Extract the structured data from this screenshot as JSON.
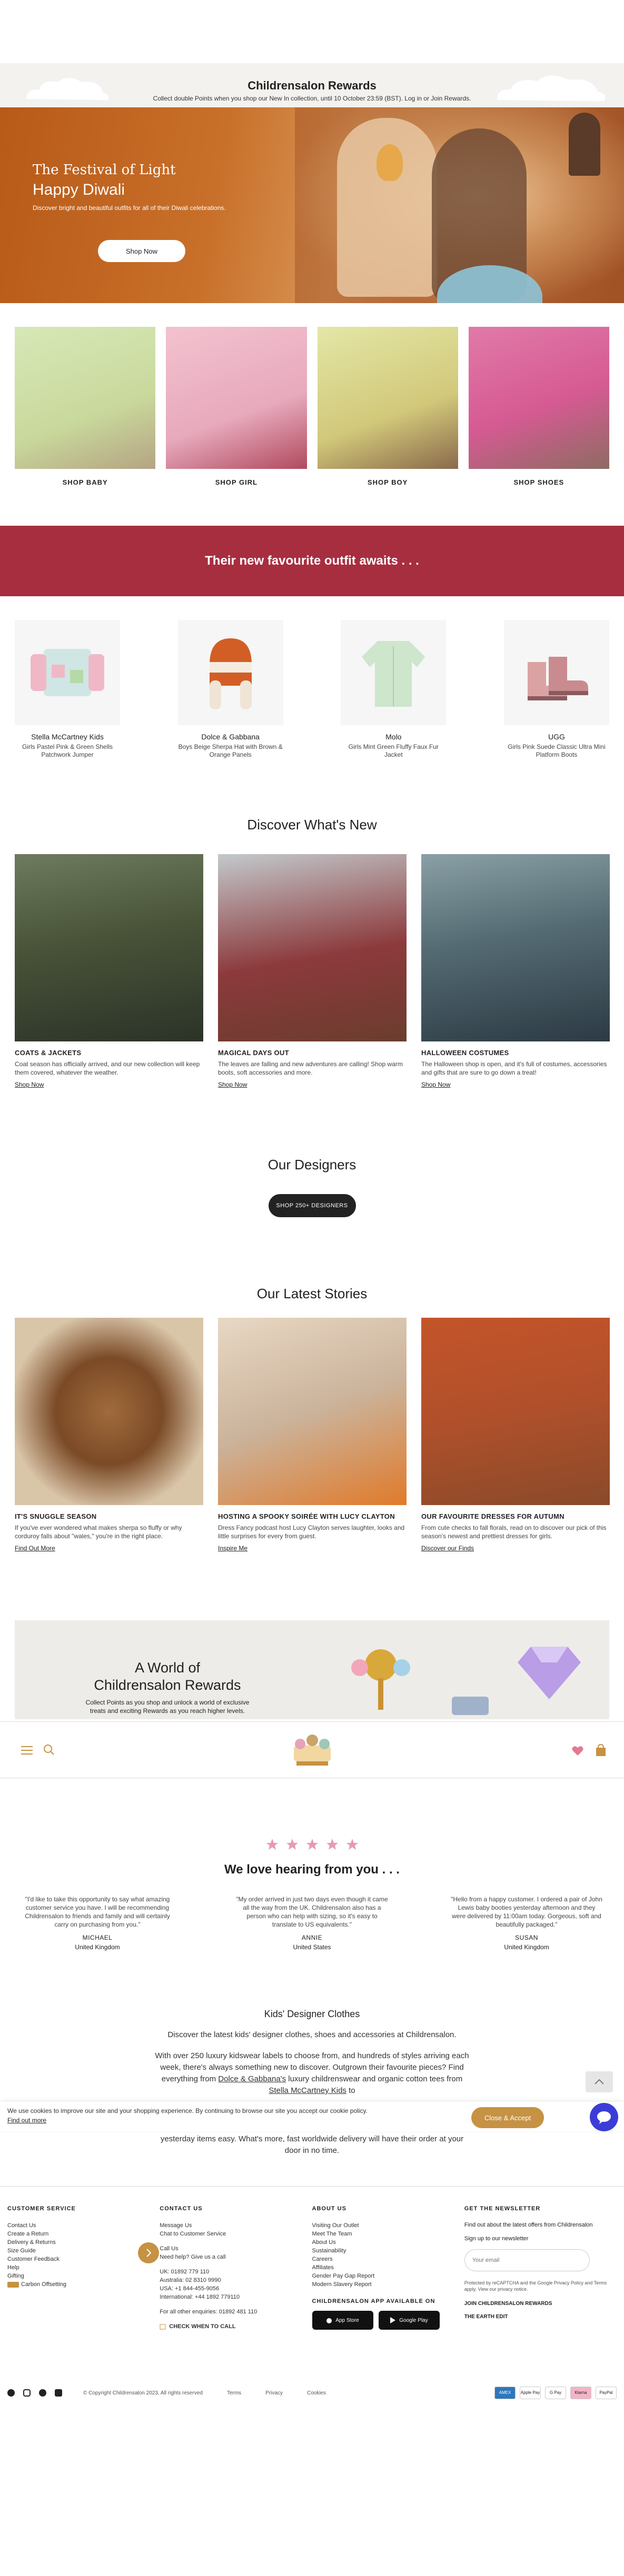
{
  "rewards_bar": {
    "title": "Childrensalon Rewards",
    "text": "Collect double Points when you shop our New In collection, until 10 October 23:59 (BST). Log in or Join Rewards."
  },
  "hero": {
    "heading_script": "The Festival of Light",
    "heading": "Happy Diwali",
    "subtext": "Discover bright and beautiful outfits for all of their Diwali celebrations.",
    "button": "Shop Now"
  },
  "shop_categories": [
    "SHOP BABY",
    "SHOP GIRL",
    "SHOP BOY",
    "SHOP SHOES"
  ],
  "promo": {
    "title": "Their new favourite outfit awaits . . ."
  },
  "products": [
    {
      "brand": "Stella McCartney Kids",
      "name": "Girls Pastel Pink & Green Shells Patchwork Jumper"
    },
    {
      "brand": "Dolce & Gabbana",
      "name": "Boys Beige Sherpa Hat with Brown & Orange Panels"
    },
    {
      "brand": "Molo",
      "name": "Girls Mint Green Fluffy Faux Fur Jacket"
    },
    {
      "brand": "UGG",
      "name": "Girls Pink Suede Classic Ultra Mini Platform Boots"
    }
  ],
  "whats_new": {
    "title": "Discover What's New",
    "cards": [
      {
        "title": "COATS & JACKETS",
        "text": "Coat season has officially arrived, and our new collection will keep them covered, whatever the weather.",
        "link": "Shop Now"
      },
      {
        "title": "MAGICAL DAYS OUT",
        "text": "The leaves are falling and new adventures are calling! Shop warm boots, soft accessories and more.",
        "link": "Shop Now"
      },
      {
        "title": "HALLOWEEN COSTUMES",
        "text": "The Halloween shop is open, and it's full of costumes, accessories and gifts that are sure to go down a treat!",
        "link": "Shop Now"
      }
    ]
  },
  "designers": {
    "title": "Our Designers",
    "button": "SHOP 250+ DESIGNERS"
  },
  "stories": {
    "title": "Our Latest Stories",
    "cards": [
      {
        "title": "IT'S SNUGGLE SEASON",
        "text": "If you've ever wondered what makes sherpa so fluffy or why corduroy falls about \"wales,\" you're in the right place.",
        "link": "Find Out More"
      },
      {
        "title": "HOSTING A SPOOKY SOIRÉE WITH LUCY CLAYTON",
        "text": "Dress Fancy podcast host Lucy Clayton serves laughter, looks and little surprises for every from guest.",
        "link": "Inspire Me"
      },
      {
        "title": "OUR FAVOURITE DRESSES FOR AUTUMN",
        "text": "From cute checks to fall florals, read on to discover our pick of this season's newest and prettiest dresses for girls.",
        "link": "Discover our Finds"
      }
    ]
  },
  "world": {
    "title": "A World of Childrensalon Rewards",
    "text": "Collect Points as you shop and unlock a world of exclusive treats and exciting Rewards as you reach higher levels."
  },
  "testimonials": {
    "title": "We love hearing from you . . .",
    "items": [
      {
        "quote": "\"I'd like to take this opportunity to say what amazing customer service you have. I will be recommending Childrensalon to friends and family and will certainly carry on purchasing from you.\"",
        "name": "MICHAEL",
        "country": "United Kingdom"
      },
      {
        "quote": "\"My order arrived in just two days even though it came all the way from the UK. Childrensalon also has a person who can help with sizing, so it's easy to translate to US equivalents.\"",
        "name": "ANNIE",
        "country": "United States"
      },
      {
        "quote": "\"Hello from a happy customer. I ordered a pair of John Lewis baby booties yesterday afternoon and they were delivered by 11:00am today. Gorgeous, soft and beautifully packaged.\"",
        "name": "SUSAN",
        "country": "United Kingdom"
      }
    ]
  },
  "seo": {
    "title": "Kids' Designer Clothes",
    "p1": "Discover the latest kids' designer clothes, shoes and accessories at Childrensalon.",
    "p2_start": "With over 250 luxury kidswear labels to choose from, and hundreds of styles arriving each week, there's always something new to discover. Outgrown their favourite pieces? Find everything from ",
    "p2_link1": "Dolce & Gabbana's",
    "p2_mid": " luxury childrenswear and organic cotton tees from ",
    "p2_link2": "Stella McCartney Kids",
    "p2_end": " to",
    "tail": "yesterday items easy. What's more, fast worldwide delivery will have their order at your door in no time."
  },
  "cookie": {
    "text": "We use cookies to improve our site and your shopping experience. By continuing to browse our site you accept our cookie policy.",
    "link": "Find out more",
    "button": "Close & Accept"
  },
  "footer": {
    "customer_service": {
      "title": "CUSTOMER SERVICE",
      "items": [
        "Contact Us",
        "Create a Return",
        "Delivery & Returns",
        "Size Guide",
        "Customer Feedback",
        "Help",
        "Gifting",
        "Carbon Offsetting"
      ]
    },
    "contact_us": {
      "title": "CONTACT US",
      "group1": [
        "Message Us",
        "Chat to Customer Service"
      ],
      "group2": [
        "Call Us",
        "Need help? Give us a call"
      ],
      "group3": [
        "UK: 01892 779 110",
        "Australia: 02 8310 9990",
        "USA: +1 844-455-9056",
        "International: +44 1892 779110"
      ],
      "other": "For all other enquiries: 01892 481 110",
      "callback": "CHECK WHEN TO CALL"
    },
    "about_us": {
      "title": "ABOUT US",
      "items": [
        "Visiting Our Outlet",
        "Meet The Team",
        "About Us",
        "Sustainability",
        "Careers",
        "Affiliates",
        "Gender Pay Gap Report",
        "Modern Slavery Report"
      ],
      "app_title": "CHILDRENSALON APP AVAILABLE ON",
      "app_store": "App Store",
      "google_play": "Google Play"
    },
    "newsletter": {
      "title": "GET THE NEWSLETTER",
      "text": "Find out about the latest offers from Childrensalon",
      "signup": "Sign up to our newsletter",
      "placeholder": "Your email",
      "legal": "Protected by reCAPTCHA and the Google Privacy Policy and Terms apply. View our privacy notice.",
      "join": "JOIN CHILDRENSALON REWARDS",
      "earth": "THE EARTH EDIT"
    },
    "copyright": "© Copyright Childrensalon 2023, All rights reserved",
    "legal_links": [
      "Terms",
      "Privacy",
      "Cookies"
    ],
    "payments": [
      "AMEX",
      "Apple Pay",
      "G Pay",
      "Klarna",
      "PayPal"
    ]
  },
  "colors": {
    "promo_red": "#a72e3f",
    "accent_gold": "#c69243",
    "chat_blue": "#3b3dd6",
    "hero_orange": "#c8702a"
  }
}
